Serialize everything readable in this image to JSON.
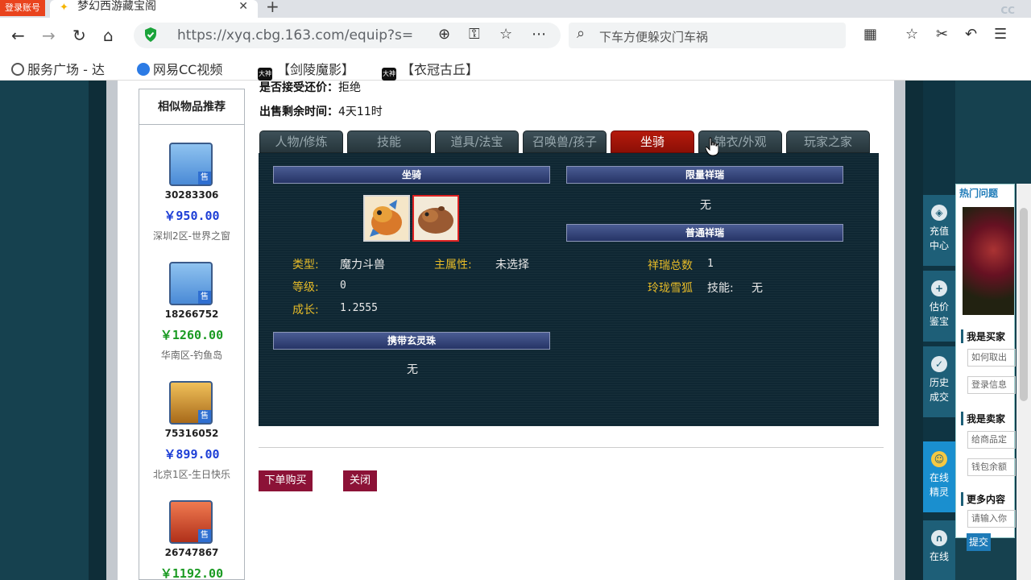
{
  "browser": {
    "login_badge": "登录账号",
    "tab_title": "梦幻西游藏宝阁",
    "tab_close": "✕",
    "new_tab": "+",
    "url": "https://xyq.cbg.163.com/equip?s=",
    "search_placeholder": "下车方便躲灾门车祸",
    "bookmarks": [
      {
        "label": "服务广场 - 达"
      },
      {
        "label": "网易CC视频"
      },
      {
        "label": "【剑陵魔影】",
        "badge": "大神"
      },
      {
        "label": "【衣冠古丘】",
        "badge": "大神"
      }
    ],
    "watermark": "CC直播"
  },
  "similar": {
    "title": "相似物品推荐",
    "items": [
      {
        "id": "30283306",
        "price": "￥950.00",
        "price_color": "#1e3fd6",
        "server": "深圳2区-世界之窗",
        "sell_badge": "售",
        "avatar_color": "#4a8ad6"
      },
      {
        "id": "18266752",
        "price": "￥1260.00",
        "price_color": "#1a9a22",
        "server": "华南区-钓鱼岛",
        "sell_badge": "售",
        "avatar_color": "#4a8ad6"
      },
      {
        "id": "75316052",
        "price": "￥899.00",
        "price_color": "#1e3fd6",
        "server": "北京1区-生日快乐",
        "sell_badge": "售",
        "avatar_color": "#d49a2a"
      },
      {
        "id": "26747867",
        "price": "￥1192.00",
        "price_color": "#1a9a22",
        "server": "",
        "sell_badge": "售",
        "avatar_color": "#d8532a"
      }
    ]
  },
  "info": {
    "bargain_label": "是否接受还价：",
    "bargain_value": "拒绝",
    "remaining_label": "出售剩余时间：",
    "remaining_value": "4天11时"
  },
  "tabs": [
    "人物/修炼",
    "技能",
    "道具/法宝",
    "召唤兽/孩子",
    "坐骑",
    "锦衣/外观",
    "玩家之家"
  ],
  "active_tab": "坐骑",
  "mount": {
    "header": "坐骑",
    "type_label": "类型:",
    "type_value": "魔力斗兽",
    "main_attr_label": "主属性:",
    "main_attr_value": "未选择",
    "level_label": "等级:",
    "level_value": "0",
    "growth_label": "成长:",
    "growth_value": "1.2555",
    "xuanling_header": "携带玄灵珠",
    "xuanling_value": "无"
  },
  "xiangrui": {
    "limited_header": "限量祥瑞",
    "limited_value": "无",
    "normal_header": "普通祥瑞",
    "total_label": "祥瑞总数",
    "total_value": "1",
    "item_name": "玲珑雪狐",
    "skill_label": "技能:",
    "skill_value": "无"
  },
  "actions": {
    "buy": "下单购买",
    "close": "关闭"
  },
  "sidebar": {
    "items": [
      {
        "label1": "充值",
        "label2": "中心",
        "icon": "shield-icon"
      },
      {
        "label1": "估价",
        "label2": "鉴宝",
        "icon": "plus-icon"
      },
      {
        "label1": "历史",
        "label2": "成交",
        "icon": "check-icon"
      },
      {
        "label1": "在线",
        "label2": "精灵",
        "icon": "sprite-icon"
      },
      {
        "label1": "在线",
        "label2": "",
        "icon": "headset-icon"
      }
    ]
  },
  "faq": {
    "title": "热门问题",
    "buyer_head": "我是买家",
    "buyer_q1": "如何取出",
    "buyer_q2": "登录信息",
    "seller_head": "我是卖家",
    "seller_q1": "给商品定",
    "seller_q2": "钱包余额",
    "more_head": "更多内容",
    "input_placeholder": "请输入你",
    "submit": "提交"
  }
}
